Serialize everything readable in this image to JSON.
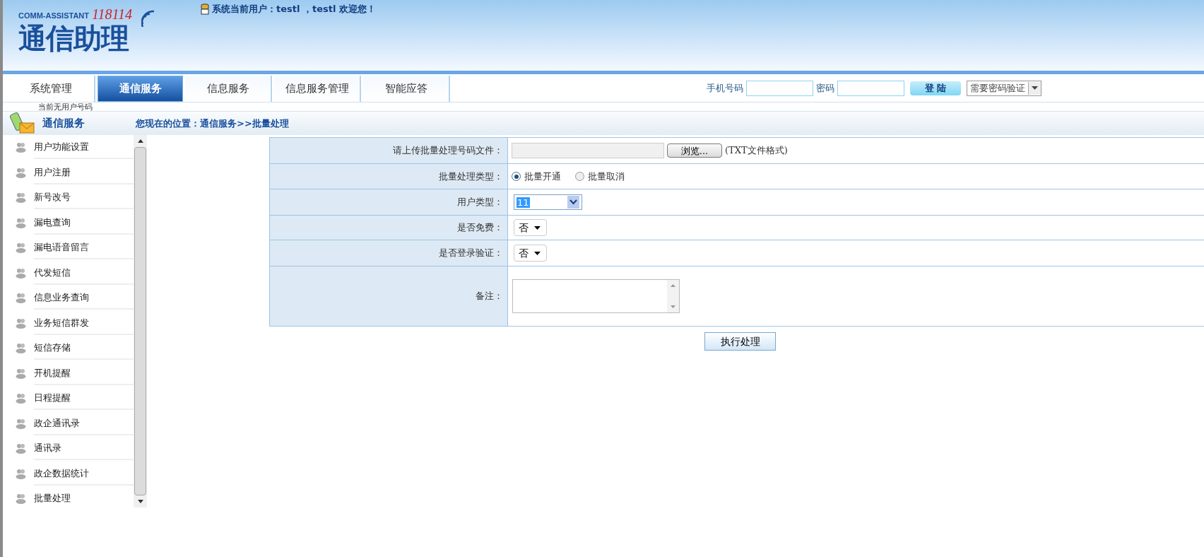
{
  "header": {
    "logo_subtitle": "COMM-ASSISTANT",
    "logo_number": "118114",
    "logo_title": "通信助理",
    "user_greeting": "系统当前用户：testl ，testl 欢迎您！"
  },
  "tabs": [
    {
      "label": "系统管理",
      "selected": false
    },
    {
      "label": "通信服务",
      "selected": true
    },
    {
      "label": "信息服务",
      "selected": false
    },
    {
      "label": "信息服务管理",
      "selected": false
    },
    {
      "label": "智能应答",
      "selected": false
    }
  ],
  "overlay_notice": "当前无用户号码",
  "login": {
    "phone_label": "手机号码",
    "password_label": "密码",
    "login_button": "登 陆",
    "mode_select": "需要密码验证"
  },
  "section_title": "通信服务",
  "breadcrumb": "您现在的位置：通信服务>>批量处理",
  "sidebar": {
    "items": [
      "用户功能设置",
      "用户注册",
      "新号改号",
      "漏电查询",
      "漏电语音留言",
      "代发短信",
      "信息业务查询",
      "业务短信群发",
      "短信存储",
      "开机提醒",
      "日程提醒",
      "政企通讯录",
      "通讯录",
      "政企数据统计",
      "批量处理"
    ]
  },
  "form": {
    "rows": [
      {
        "kind": "file",
        "label": "请上传批量处理号码文件：",
        "button": "浏览...",
        "hint": "(TXT文件格式)"
      },
      {
        "kind": "radio",
        "label": "批量处理类型：",
        "options": [
          {
            "label": "批量开通",
            "selected": true
          },
          {
            "label": "批量取消",
            "selected": false
          }
        ]
      },
      {
        "kind": "highlight-select",
        "label": "用户类型：",
        "value": "11"
      },
      {
        "kind": "select",
        "label": "是否免费：",
        "value": "否"
      },
      {
        "kind": "select",
        "label": "是否登录验证：",
        "value": "否"
      },
      {
        "kind": "textarea",
        "label": "备注："
      }
    ],
    "submit": "执行处理"
  }
}
